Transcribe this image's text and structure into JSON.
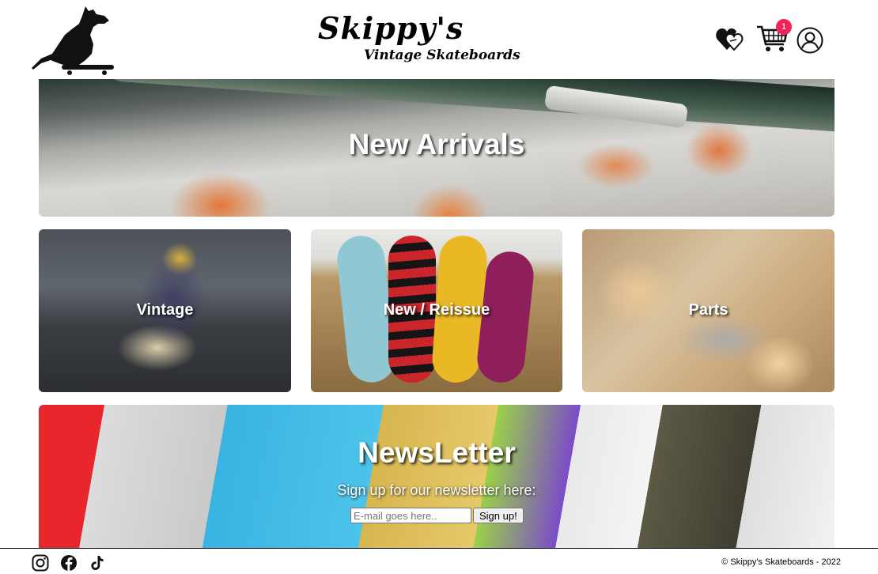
{
  "header": {
    "brand_title": "Skippy's",
    "brand_subtitle": "Vintage Skateboards",
    "cart_count": "1",
    "icons": [
      "kangaroo-skateboard-logo",
      "wishlist-heart-icon",
      "shopping-cart-icon",
      "user-account-icon"
    ]
  },
  "banners": {
    "new_arrivals": "New Arrivals",
    "vintage": "Vintage",
    "new_reissue": "New / Reissue",
    "parts": "Parts"
  },
  "newsletter": {
    "title": "NewsLetter",
    "subtitle": "Sign up for our newsletter here:",
    "input_placeholder": "E-mail goes here..",
    "button_label": "Sign up!"
  },
  "footer": {
    "social_icons": [
      "instagram-icon",
      "facebook-icon",
      "tiktok-icon"
    ],
    "copyright": "© Skippy's Skateboards - 2022"
  },
  "colors": {
    "badge": "#f0245a",
    "background": "#ffffff",
    "text": "#000000"
  }
}
